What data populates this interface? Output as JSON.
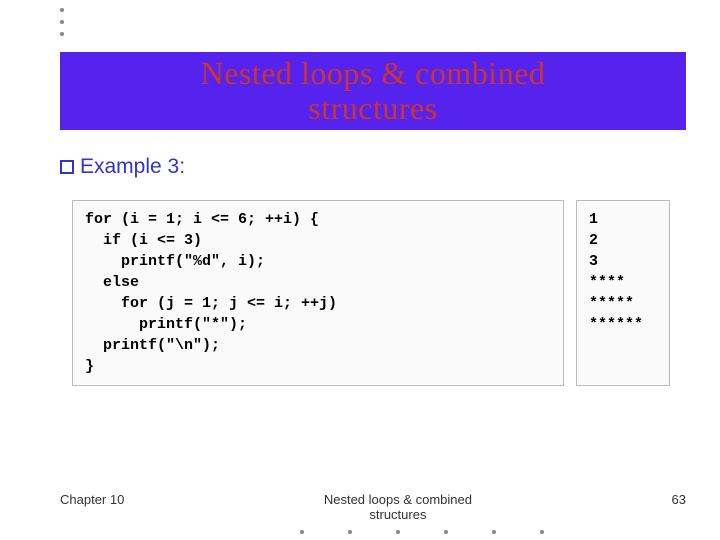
{
  "title": "Nested loops & combined\nstructures",
  "subtitle": "Example 3:",
  "code": "for (i = 1; i <= 6; ++i) {\n  if (i <= 3)\n    printf(\"%d\", i);\n  else\n    for (j = 1; j <= i; ++j)\n      printf(\"*\");\n  printf(\"\\n\");\n}",
  "output": "1\n2\n3\n****\n*****\n******",
  "footer": {
    "left": "Chapter 10",
    "mid": "Nested loops & combined\nstructures",
    "right": "63"
  }
}
